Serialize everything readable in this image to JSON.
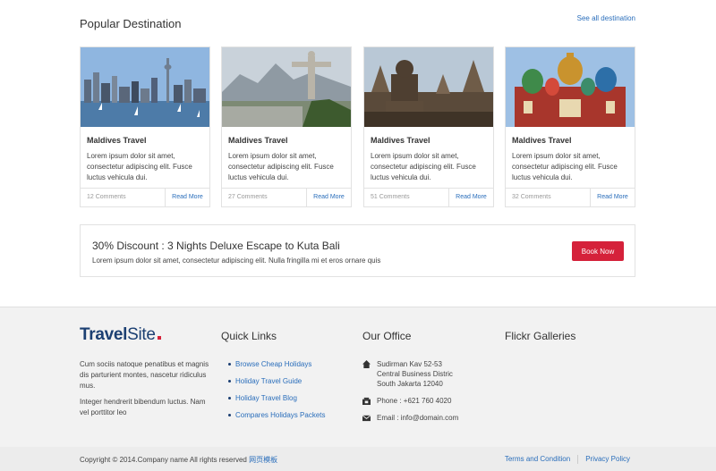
{
  "popular": {
    "title": "Popular Destination",
    "see_all": "See all destination",
    "cards": [
      {
        "title": "Maldives Travel",
        "description": "Lorem ipsum dolor sit amet, consectetur adipiscing elit. Fusce luctus vehicula dui.",
        "comments": "12 Comments",
        "read_more": "Read More"
      },
      {
        "title": "Maldives Travel",
        "description": "Lorem ipsum dolor sit amet, consectetur adipiscing elit. Fusce luctus vehicula dui.",
        "comments": "27 Comments",
        "read_more": "Read More"
      },
      {
        "title": "Maldives Travel",
        "description": "Lorem ipsum dolor sit amet, consectetur adipiscing elit. Fusce luctus vehicula dui.",
        "comments": "51 Comments",
        "read_more": "Read More"
      },
      {
        "title": "Maldives Travel",
        "description": "Lorem ipsum dolor sit amet, consectetur adipiscing elit. Fusce luctus vehicula dui.",
        "comments": "32 Comments",
        "read_more": "Read More"
      }
    ]
  },
  "promo": {
    "title": "30% Discount : 3 Nights Deluxe Escape to Kuta Bali",
    "text": "Lorem ipsum dolor sit amet, consectetur adipiscing elit. Nulla fringilla mi et eros ornare quis",
    "button": "Book Now"
  },
  "footer": {
    "logo_bold": "Travel",
    "logo_light": "Site",
    "about": [
      "Cum sociis natoque penatibus et magnis dis parturient montes, nascetur ridiculus mus.",
      "Integer hendrerit bibendum luctus. Nam vel porttitor leo"
    ],
    "quick_links_title": "Quick Links",
    "quick_links": [
      "Browse Cheap Holidays",
      "Holiday Travel Guide",
      "Holiday Travel Blog",
      "Compares Holidays Packets"
    ],
    "office_title": "Our Office",
    "office": {
      "address_lines": [
        "Sudirman Kav 52-53",
        "Central Business Distric",
        "South Jakarta 12040"
      ],
      "phone": "Phone : +621 760 4020",
      "email": "Email : info@domain.com"
    },
    "flickr_title": "Flickr Galleries"
  },
  "bottom": {
    "copyright": "Copyright © 2014.Company name All rights reserved",
    "copyright_link": "网页模板",
    "terms": "Terms and Condition",
    "privacy": "Privacy Policy"
  },
  "icons": {
    "address": "home-icon",
    "phone": "phone-icon",
    "email": "envelope-icon"
  },
  "colors": {
    "accent": "#d5213a",
    "link": "#2a6ebb",
    "brand": "#1b3f72"
  }
}
